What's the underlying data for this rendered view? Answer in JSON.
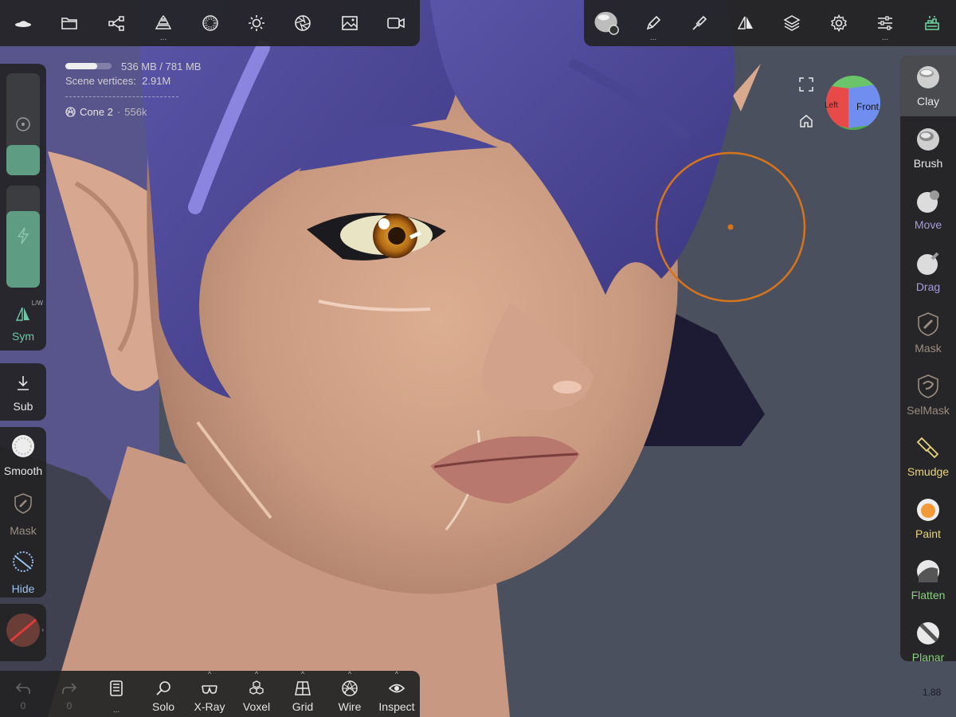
{
  "stats": {
    "memory": "536 MB / 781 MB",
    "memory_fraction": 0.69,
    "vertices_label": "Scene vertices",
    "vertices_value": "2.91M",
    "separator": "--------------------------------",
    "mesh_name": "Cone 2",
    "mesh_count": "556k"
  },
  "top_left": {
    "buttons": [
      {
        "name": "nomad-logo-icon"
      },
      {
        "name": "folder-icon"
      },
      {
        "name": "scene-graph-icon"
      },
      {
        "name": "primitive-stack-icon",
        "dots": "..."
      },
      {
        "name": "material-sphere-icon"
      },
      {
        "name": "light-sun-icon"
      },
      {
        "name": "camera-aperture-icon"
      },
      {
        "name": "image-icon"
      },
      {
        "name": "video-camera-icon"
      }
    ]
  },
  "top_right": {
    "buttons": [
      {
        "name": "material-settings-icon"
      },
      {
        "name": "brush-pen-icon",
        "dots": "..."
      },
      {
        "name": "stroke-tool-icon"
      },
      {
        "name": "symmetry-icon"
      },
      {
        "name": "layers-icon"
      },
      {
        "name": "gear-icon"
      },
      {
        "name": "sliders-icon",
        "dots": "..."
      },
      {
        "name": "plugin-icon"
      }
    ]
  },
  "left": {
    "sym_label": "Sym",
    "sym_badge": "L/W",
    "sub_label": "Sub",
    "smooth_label": "Smooth",
    "mask_label": "Mask",
    "hide_label": "Hide",
    "radius_fraction": 0.3,
    "intensity_fraction": 0.75
  },
  "right_tools": [
    {
      "id": "clay",
      "label": "Clay",
      "color": "#e8e8e8",
      "active": true
    },
    {
      "id": "brush",
      "label": "Brush",
      "color": "#e8e8e8"
    },
    {
      "id": "move",
      "label": "Move",
      "color": "#a69cdb"
    },
    {
      "id": "drag",
      "label": "Drag",
      "color": "#a69cdb"
    },
    {
      "id": "mask",
      "label": "Mask",
      "color": "#9a8d80"
    },
    {
      "id": "selmask",
      "label": "SelMask",
      "color": "#9a8d80"
    },
    {
      "id": "smudge",
      "label": "Smudge",
      "color": "#e8d47a"
    },
    {
      "id": "paint",
      "label": "Paint",
      "color": "#e8d47a"
    },
    {
      "id": "flatten",
      "label": "Flatten",
      "color": "#8ccf82"
    },
    {
      "id": "planar",
      "label": "Planar",
      "color": "#8ccf82"
    }
  ],
  "bottom": {
    "undo_count": "0",
    "redo_count": "0",
    "book_dots": "...",
    "solo_label": "Solo",
    "xray_label": "X-Ray",
    "voxel_label": "Voxel",
    "grid_label": "Grid",
    "wire_label": "Wire",
    "inspect_label": "Inspect"
  },
  "gizmo": {
    "left_label": "Left",
    "front_label": "Front"
  },
  "version": "1.88",
  "colors": {
    "accent_green": "#5e9c84",
    "brush_ring": "#d6741c",
    "panel_bg": "#242426"
  }
}
